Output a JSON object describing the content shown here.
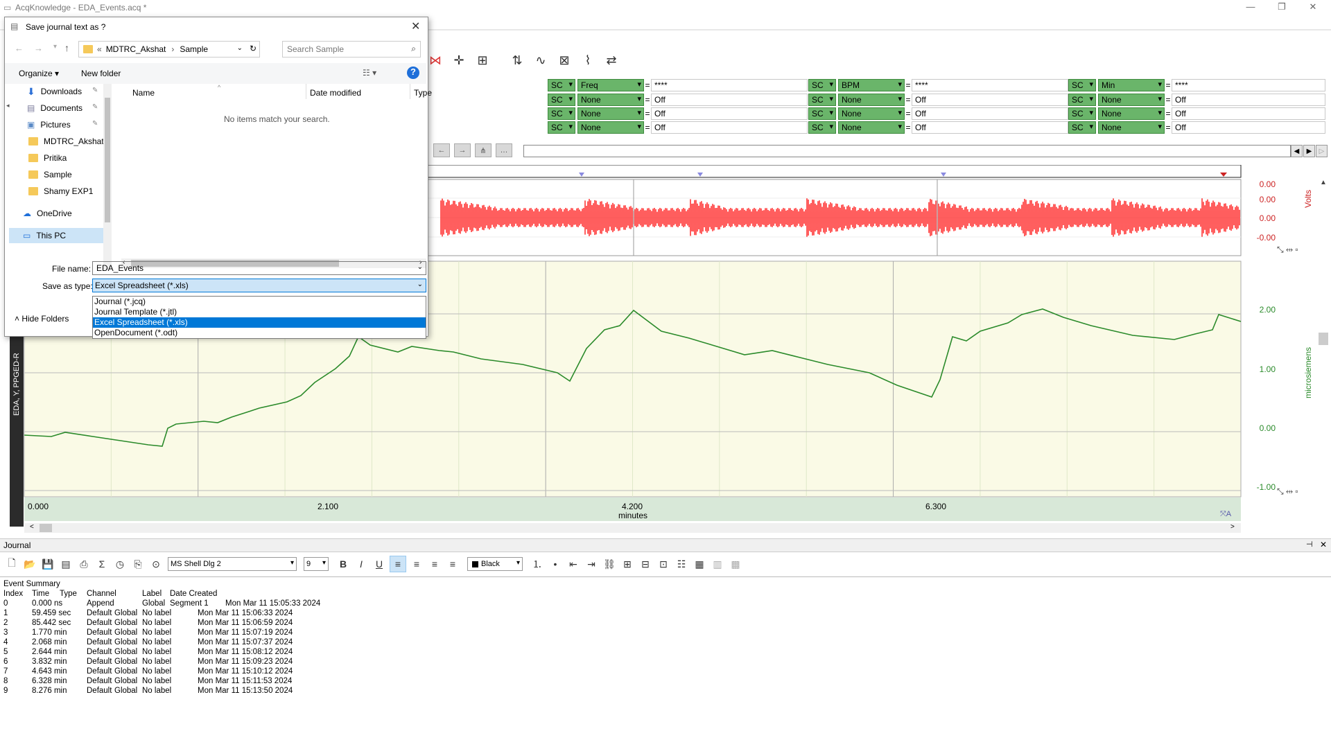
{
  "window": {
    "title": "AcqKnowledge - EDA_Events.acq *"
  },
  "measurements": {
    "groups": [
      {
        "rows": [
          {
            "channel": "SC",
            "type": "Freq",
            "value": "****"
          },
          {
            "channel": "SC",
            "type": "None",
            "value": "Off"
          },
          {
            "channel": "SC",
            "type": "None",
            "value": "Off"
          },
          {
            "channel": "SC",
            "type": "None",
            "value": "Off"
          }
        ]
      },
      {
        "rows": [
          {
            "channel": "SC",
            "type": "BPM",
            "value": "****"
          },
          {
            "channel": "SC",
            "type": "None",
            "value": "Off"
          },
          {
            "channel": "SC",
            "type": "None",
            "value": "Off"
          },
          {
            "channel": "SC",
            "type": "None",
            "value": "Off"
          }
        ]
      },
      {
        "rows": [
          {
            "channel": "SC",
            "type": "Min",
            "value": "****"
          },
          {
            "channel": "SC",
            "type": "None",
            "value": "Off"
          },
          {
            "channel": "SC",
            "type": "None",
            "value": "Off"
          },
          {
            "channel": "SC",
            "type": "None",
            "value": "Off"
          }
        ]
      }
    ],
    "equals": "="
  },
  "plot": {
    "top_channel": {
      "unit": "Volts",
      "ticks": [
        "0.00",
        "0.00",
        "0.00",
        "-0.00"
      ],
      "color": "#ff0000"
    },
    "bottom_channel": {
      "label": "EDA, Y, PPGED-R",
      "unit": "microsiemens",
      "ticks": [
        "2.00",
        "1.00",
        "0.00",
        "-1.00"
      ],
      "color": "#2a8a2a",
      "background": "#fafae6"
    },
    "x_ticks": [
      "0.000",
      "2.100",
      "4.200",
      "6.300"
    ],
    "x_unit": "minutes"
  },
  "journal": {
    "title": "Journal",
    "font": "MS Shell Dlg 2",
    "size": "9",
    "color_name": "Black",
    "summary_title": "Event Summary",
    "headers": [
      "Index",
      "Time",
      "Type",
      "Channel",
      "Label",
      "Date Created"
    ],
    "rows": [
      [
        "0",
        "0.000 ns",
        "Append",
        "Global",
        "Segment 1",
        "Mon Mar 11 15:05:33 2024"
      ],
      [
        "1",
        "59.459 sec",
        "Default",
        "Global",
        "No label",
        "Mon Mar 11 15:06:33 2024"
      ],
      [
        "2",
        "85.442 sec",
        "Default",
        "Global",
        "No label",
        "Mon Mar 11 15:06:59 2024"
      ],
      [
        "3",
        "1.770 min",
        "Default",
        "Global",
        "No label",
        "Mon Mar 11 15:07:19 2024"
      ],
      [
        "4",
        "2.068 min",
        "Default",
        "Global",
        "No label",
        "Mon Mar 11 15:07:37 2024"
      ],
      [
        "5",
        "2.644 min",
        "Default",
        "Global",
        "No label",
        "Mon Mar 11 15:08:12 2024"
      ],
      [
        "6",
        "3.832 min",
        "Default",
        "Global",
        "No label",
        "Mon Mar 11 15:09:23 2024"
      ],
      [
        "7",
        "4.643 min",
        "Default",
        "Global",
        "No label",
        "Mon Mar 11 15:10:12 2024"
      ],
      [
        "8",
        "6.328 min",
        "Default",
        "Global",
        "No label",
        "Mon Mar 11 15:11:53 2024"
      ],
      [
        "9",
        "8.276 min",
        "Default",
        "Global",
        "No label",
        "Mon Mar 11 15:13:50 2024"
      ]
    ]
  },
  "dialog": {
    "title": "Save journal text as ?",
    "breadcrumb": [
      "«",
      "MDTRC_Akshat",
      "Sample"
    ],
    "search_placeholder": "Search Sample",
    "organize": "Organize",
    "new_folder": "New folder",
    "columns": [
      "Name",
      "Date modified",
      "Type"
    ],
    "empty_message": "No items match your search.",
    "nav_items": [
      "Downloads",
      "Documents",
      "Pictures",
      "MDTRC_Akshat",
      "Pritika",
      "Sample",
      "Shamy EXP1",
      "OneDrive",
      "This PC"
    ],
    "file_name_label": "File name:",
    "file_name_value": "EDA_Events",
    "save_type_label": "Save as type:",
    "save_type_value": "Excel Spreadsheet (*.xls)",
    "type_options": [
      "Journal (*.jcq)",
      "Journal Template (*.jtl)",
      "Excel Spreadsheet (*.xls)",
      "OpenDocument (*.odt)"
    ],
    "selected_type_index": 2,
    "hide_folders": "Hide Folders"
  }
}
